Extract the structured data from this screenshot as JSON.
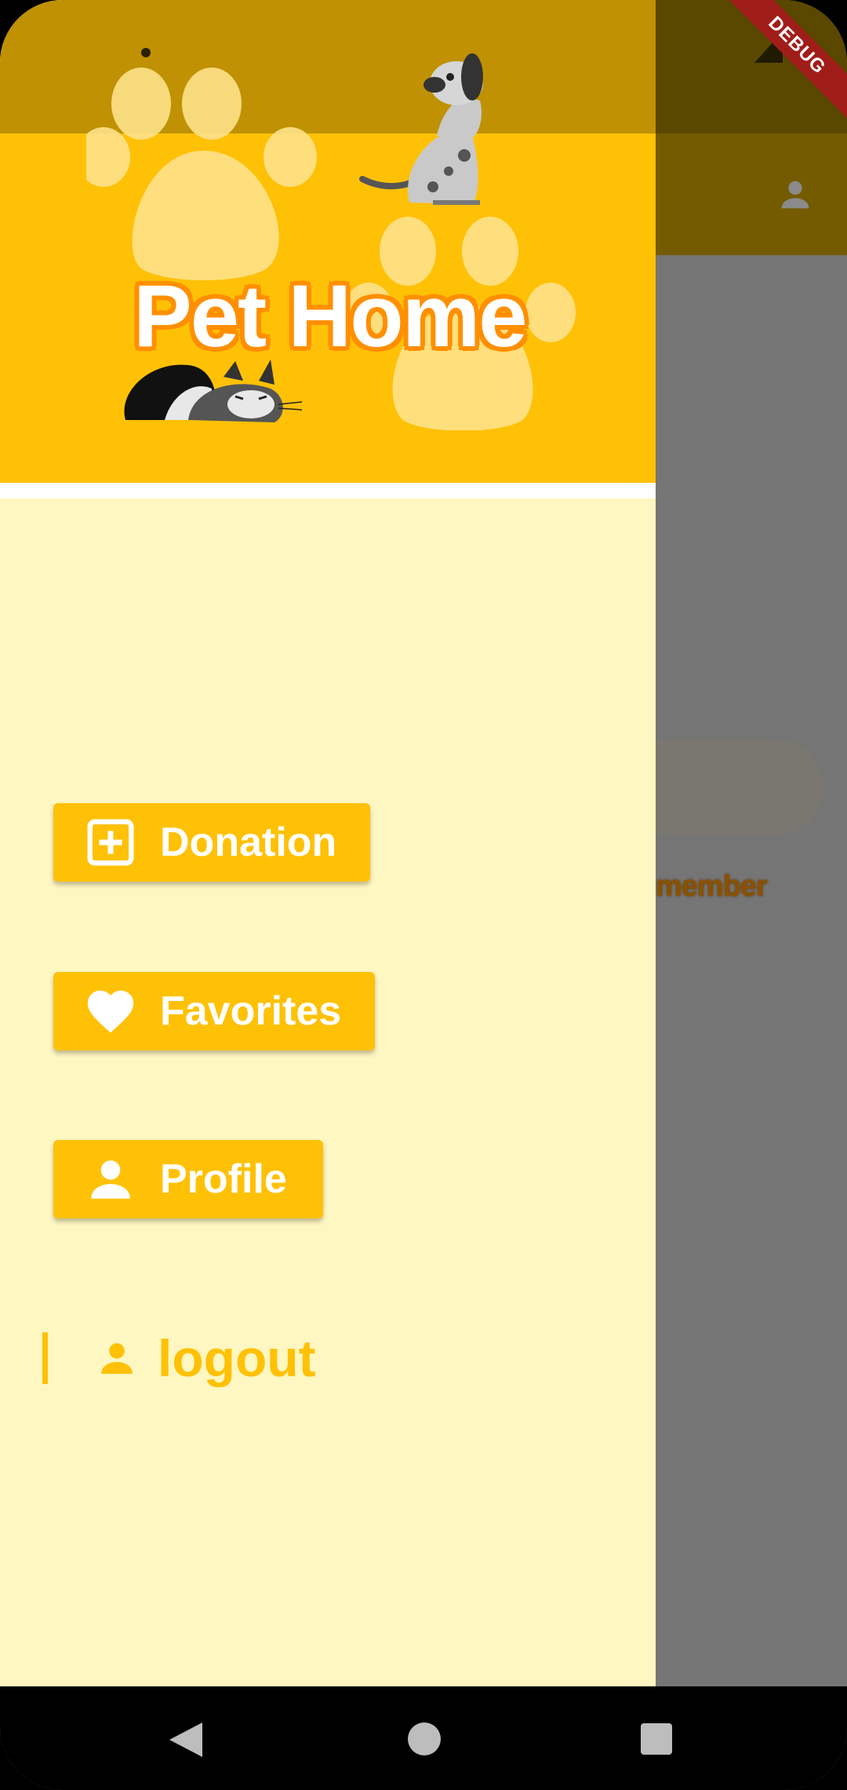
{
  "app": {
    "title": "Pet Home",
    "debug_banner": "DEBUG"
  },
  "underlying": {
    "partial_text": "member",
    "account_icon": "person-icon"
  },
  "drawer": {
    "items": [
      {
        "label": "Donation",
        "icon": "add-box-icon"
      },
      {
        "label": "Favorites",
        "icon": "heart-icon"
      },
      {
        "label": "Profile",
        "icon": "person-icon"
      }
    ],
    "logout": {
      "label": "logout",
      "icon": "person-icon"
    }
  },
  "nav": {
    "back": "back-icon",
    "home": "home-icon",
    "recents": "recents-icon"
  },
  "colors": {
    "accent": "#ffc106",
    "drawer_bg": "#fff7c1",
    "title_outline": "#ff8f00",
    "debug": "#a11d19"
  }
}
